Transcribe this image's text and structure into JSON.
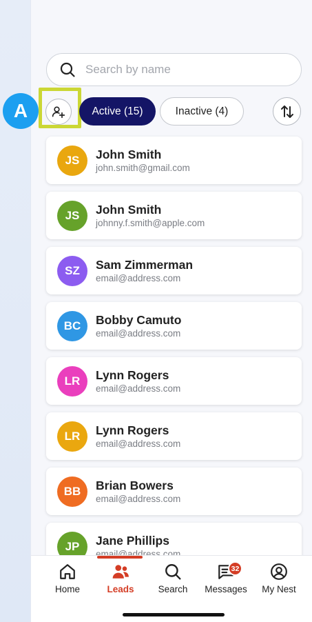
{
  "search": {
    "placeholder": "Search by name"
  },
  "filters": {
    "active_label": "Active (15)",
    "inactive_label": "Inactive (4)"
  },
  "marker": {
    "label": "A"
  },
  "leads": [
    {
      "initials": "JS",
      "name": "John Smith",
      "email": "john.smith@gmail.com",
      "color": "#e9a70f"
    },
    {
      "initials": "JS",
      "name": "John Smith",
      "email": "johnny.f.smith@apple.com",
      "color": "#66a22a"
    },
    {
      "initials": "SZ",
      "name": "Sam Zimmerman",
      "email": "email@address.com",
      "color": "#8c5cf0"
    },
    {
      "initials": "BC",
      "name": "Bobby Camuto",
      "email": "email@address.com",
      "color": "#2f97e4"
    },
    {
      "initials": "LR",
      "name": "Lynn Rogers",
      "email": "email@address.com",
      "color": "#ea3fbd"
    },
    {
      "initials": "LR",
      "name": "Lynn Rogers",
      "email": "email@address.com",
      "color": "#eaa70f"
    },
    {
      "initials": "BB",
      "name": "Brian Bowers",
      "email": "email@address.com",
      "color": "#ef6c22"
    },
    {
      "initials": "JP",
      "name": "Jane Phillips",
      "email": "email@address.com",
      "color": "#66a22a"
    }
  ],
  "nav": {
    "home": "Home",
    "leads": "Leads",
    "search": "Search",
    "messages": "Messages",
    "messages_badge": "32",
    "my_nest": "My Nest"
  },
  "colors": {
    "accent": "#d43d25",
    "active_chip": "#141566",
    "highlight": "#cbd735",
    "marker": "#1c9ff0"
  }
}
